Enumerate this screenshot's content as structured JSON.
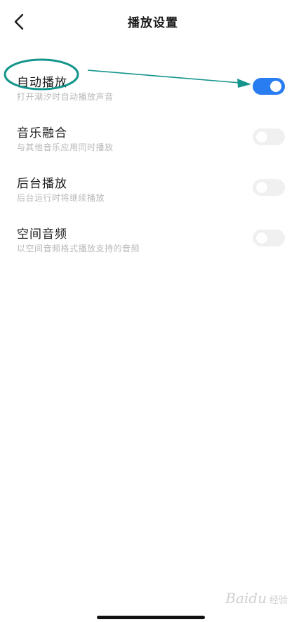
{
  "header": {
    "title": "播放设置",
    "back_icon": "chevron-left-icon"
  },
  "settings": [
    {
      "title": "自动播放",
      "desc": "打开潮汐时自动播放声音",
      "enabled": true
    },
    {
      "title": "音乐融合",
      "desc": "与其他音乐应用同时播放",
      "enabled": false
    },
    {
      "title": "后台播放",
      "desc": "后台运行时将继续播放",
      "enabled": false
    },
    {
      "title": "空间音频",
      "desc": "以空间音频格式播放支持的音频",
      "enabled": false
    }
  ],
  "colors": {
    "toggle_on": "#2a7df0",
    "toggle_off": "#f0f0f0",
    "annotation": "#13958c"
  },
  "watermark": {
    "text": "Baidu",
    "sub": "经验"
  }
}
